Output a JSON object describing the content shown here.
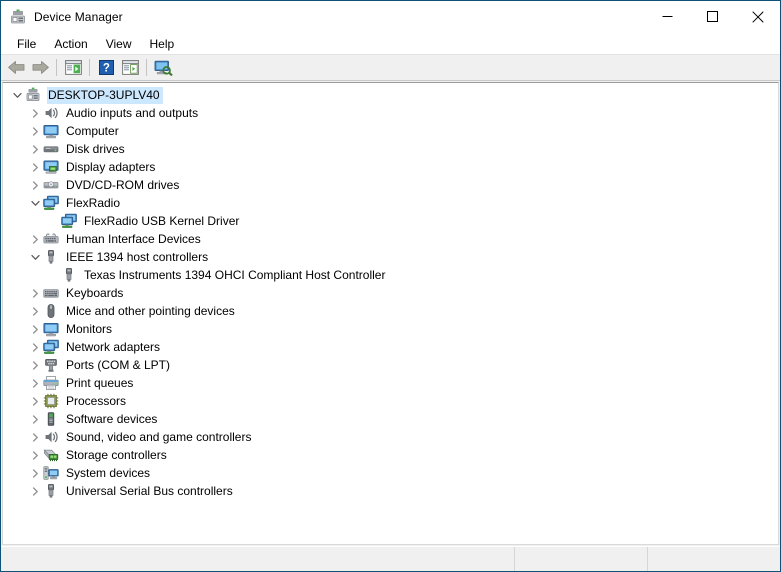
{
  "window": {
    "title": "Device Manager",
    "title_icon": "device-manager-icon",
    "frame_color": "#0e5377",
    "caption": {
      "minimize": "minimize-button",
      "maximize": "maximize-button",
      "close": "close-button"
    }
  },
  "menubar": {
    "items": [
      {
        "label": "File"
      },
      {
        "label": "Action"
      },
      {
        "label": "View"
      },
      {
        "label": "Help"
      }
    ]
  },
  "toolbar": {
    "buttons": [
      {
        "name": "back-button",
        "icon": "arrow-left-icon",
        "tooltip": "Back",
        "enabled": true
      },
      {
        "name": "forward-button",
        "icon": "arrow-right-icon",
        "tooltip": "Forward",
        "enabled": true
      },
      {
        "name": "separator-1",
        "icon": "separator",
        "tooltip": ""
      },
      {
        "name": "show-hide-console-tree-button",
        "icon": "console-tree-icon",
        "tooltip": "Show/Hide Console Tree",
        "enabled": true
      },
      {
        "name": "separator-2",
        "icon": "separator",
        "tooltip": ""
      },
      {
        "name": "help-button",
        "icon": "help-question-icon",
        "tooltip": "Help",
        "enabled": true
      },
      {
        "name": "properties-button",
        "icon": "properties-window-icon",
        "tooltip": "Properties",
        "enabled": true
      },
      {
        "name": "separator-3",
        "icon": "separator",
        "tooltip": ""
      },
      {
        "name": "scan-for-hardware-changes-button",
        "icon": "scan-hardware-icon",
        "tooltip": "Scan for hardware changes",
        "enabled": true
      }
    ]
  },
  "tree": {
    "nodes": [
      {
        "label": "DESKTOP-3UPLV40",
        "level": 0,
        "state": "expanded",
        "icon": "computer-root-icon",
        "selected": true
      },
      {
        "label": "Audio inputs and outputs",
        "level": 1,
        "state": "collapsed",
        "icon": "speaker-icon",
        "selected": false
      },
      {
        "label": "Computer",
        "level": 1,
        "state": "collapsed",
        "icon": "monitor-icon",
        "selected": false
      },
      {
        "label": "Disk drives",
        "level": 1,
        "state": "collapsed",
        "icon": "disk-drive-icon",
        "selected": false
      },
      {
        "label": "Display adapters",
        "level": 1,
        "state": "collapsed",
        "icon": "display-adapter-icon",
        "selected": false
      },
      {
        "label": "DVD/CD-ROM drives",
        "level": 1,
        "state": "collapsed",
        "icon": "optical-drive-icon",
        "selected": false
      },
      {
        "label": "FlexRadio",
        "level": 1,
        "state": "expanded",
        "icon": "network-device-icon",
        "selected": false
      },
      {
        "label": "FlexRadio USB Kernel Driver",
        "level": 2,
        "state": "leaf",
        "icon": "network-device-icon",
        "selected": false
      },
      {
        "label": "Human Interface Devices",
        "level": 1,
        "state": "collapsed",
        "icon": "hid-icon",
        "selected": false
      },
      {
        "label": "IEEE 1394 host controllers",
        "level": 1,
        "state": "expanded",
        "icon": "usb-connector-icon",
        "selected": false
      },
      {
        "label": "Texas Instruments 1394 OHCI Compliant Host Controller",
        "level": 2,
        "state": "leaf",
        "icon": "usb-connector-icon",
        "selected": false
      },
      {
        "label": "Keyboards",
        "level": 1,
        "state": "collapsed",
        "icon": "keyboard-icon",
        "selected": false
      },
      {
        "label": "Mice and other pointing devices",
        "level": 1,
        "state": "collapsed",
        "icon": "mouse-icon",
        "selected": false
      },
      {
        "label": "Monitors",
        "level": 1,
        "state": "collapsed",
        "icon": "monitor-icon",
        "selected": false
      },
      {
        "label": "Network adapters",
        "level": 1,
        "state": "collapsed",
        "icon": "network-device-icon",
        "selected": false
      },
      {
        "label": "Ports (COM & LPT)",
        "level": 1,
        "state": "collapsed",
        "icon": "port-icon",
        "selected": false
      },
      {
        "label": "Print queues",
        "level": 1,
        "state": "collapsed",
        "icon": "printer-icon",
        "selected": false
      },
      {
        "label": "Processors",
        "level": 1,
        "state": "collapsed",
        "icon": "processor-icon",
        "selected": false
      },
      {
        "label": "Software devices",
        "level": 1,
        "state": "collapsed",
        "icon": "software-device-icon",
        "selected": false
      },
      {
        "label": "Sound, video and game controllers",
        "level": 1,
        "state": "collapsed",
        "icon": "speaker-icon",
        "selected": false
      },
      {
        "label": "Storage controllers",
        "level": 1,
        "state": "collapsed",
        "icon": "storage-controller-icon",
        "selected": false
      },
      {
        "label": "System devices",
        "level": 1,
        "state": "collapsed",
        "icon": "system-device-icon",
        "selected": false
      },
      {
        "label": "Universal Serial Bus controllers",
        "level": 1,
        "state": "collapsed",
        "icon": "usb-connector-icon",
        "selected": false
      }
    ]
  },
  "statusbar": {
    "cells": [
      "",
      "",
      ""
    ]
  },
  "colors": {
    "selection": "#cce8ff",
    "toolbar_bg": "#f0f0f0",
    "statusbar_bg": "#f0f0f0",
    "window_border": "#0e5377",
    "text": "#000000"
  }
}
